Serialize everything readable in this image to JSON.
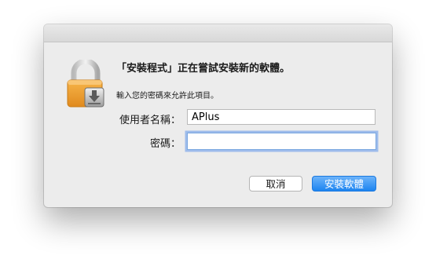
{
  "dialog": {
    "heading": "「安裝程式」正在嘗試安裝新的軟體。",
    "message": "輸入您的密碼來允許此項目。",
    "username_label": "使用者名稱：",
    "username_value": "APlus",
    "password_label": "密碼：",
    "password_value": "",
    "cancel_label": "取消",
    "install_label": "安裝軟體"
  },
  "icons": {
    "app_icon": "lock-icon"
  },
  "colors": {
    "accent": "#1d84f0",
    "focus_ring": "#5f96eb",
    "dialog_bg": "#ececec"
  }
}
